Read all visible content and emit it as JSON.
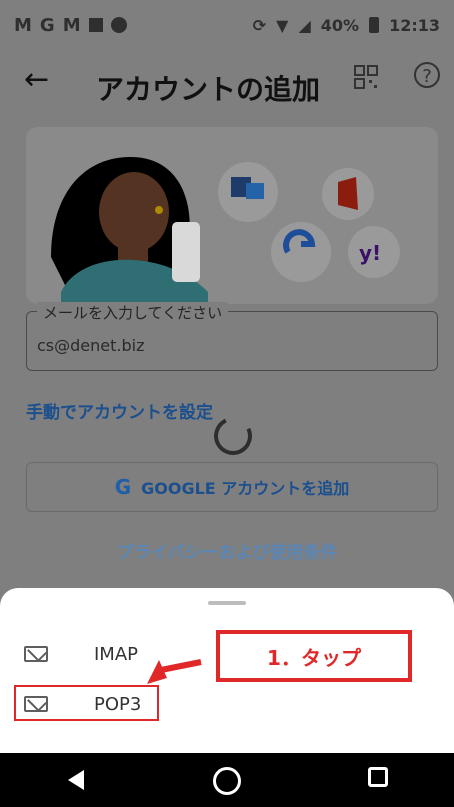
{
  "status_bar": {
    "left_icons": [
      "M",
      "G",
      "M"
    ],
    "battery_percent": "40%",
    "time": "12:13"
  },
  "app_bar": {
    "title": "アカウントの追加",
    "back_icon": "←",
    "help_icon": "?"
  },
  "form": {
    "email_label": "メールを入力してください",
    "email_value": "cs@denet.biz",
    "manual_setup_link": "手動でアカウントを設定",
    "google_button_label": "GOOGLE アカウントを追加",
    "privacy_link": "プライバシーおよび使用条件"
  },
  "sheet": {
    "options": [
      {
        "label": "IMAP"
      },
      {
        "label": "POP3"
      }
    ]
  },
  "annotation": {
    "callout_text": "1．タップ"
  },
  "colors": {
    "red": "#e02828",
    "link_blue": "#1b4f8e"
  }
}
